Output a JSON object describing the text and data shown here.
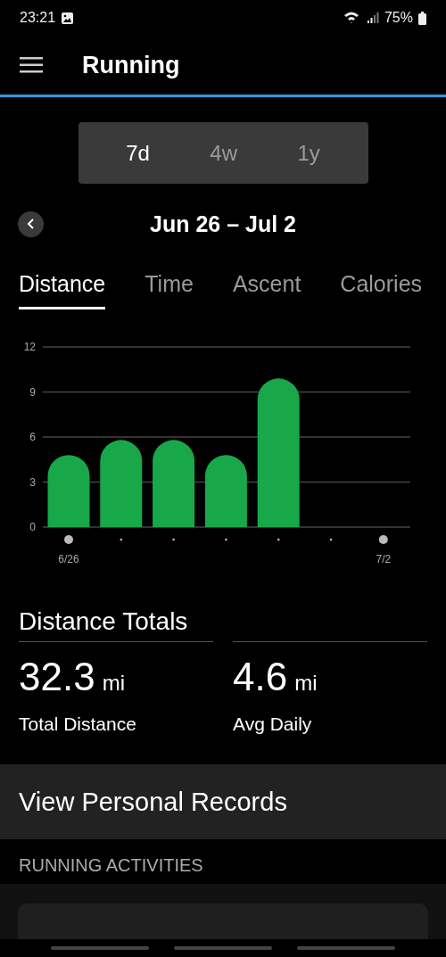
{
  "status_bar": {
    "time": "23:21",
    "battery": "75%"
  },
  "app_bar": {
    "title": "Running"
  },
  "range_selector": [
    {
      "label": "7d",
      "selected": true
    },
    {
      "label": "4w",
      "selected": false
    },
    {
      "label": "1y",
      "selected": false
    }
  ],
  "date_range": "Jun 26 – Jul 2",
  "tabs": [
    {
      "label": "Distance",
      "selected": true
    },
    {
      "label": "Time",
      "selected": false
    },
    {
      "label": "Ascent",
      "selected": false
    },
    {
      "label": "Calories",
      "selected": false
    }
  ],
  "chart": {
    "chart_data": {
      "type": "bar",
      "categories": [
        "6/26",
        null,
        null,
        null,
        null,
        null,
        "7/2"
      ],
      "ylim": [
        0,
        12
      ],
      "grid": true,
      "yticks": [
        0,
        3,
        6,
        9,
        12
      ],
      "series": [
        {
          "color": "#18a84a",
          "values": [
            4.8,
            5.8,
            5.8,
            4.8,
            9.9,
            null,
            null
          ]
        }
      ]
    }
  },
  "totals": {
    "title": "Distance Totals",
    "items": [
      {
        "value": "32.3",
        "unit": "mi",
        "label": "Total Distance"
      },
      {
        "value": "4.6",
        "unit": "mi",
        "label": "Avg Daily"
      }
    ]
  },
  "personal_records": "View Personal Records",
  "activities_header": "RUNNING ACTIVITIES"
}
